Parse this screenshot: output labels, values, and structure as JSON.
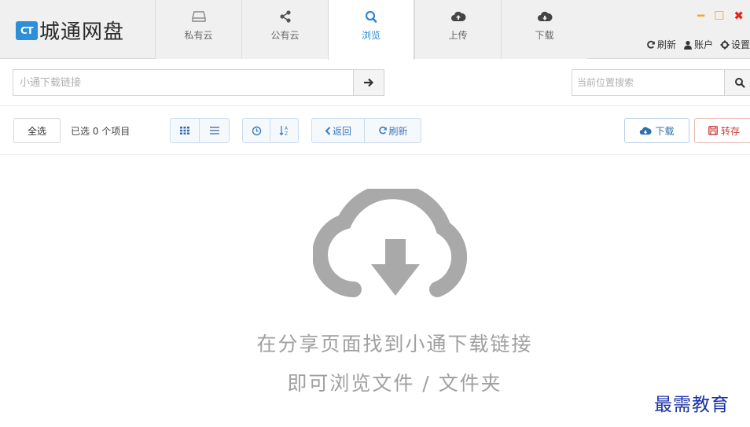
{
  "app": {
    "logo_mark": "CT",
    "name": "城通网盘"
  },
  "nav": {
    "tabs": [
      {
        "label": "私有云",
        "icon": "drive-icon"
      },
      {
        "label": "公有云",
        "icon": "share-icon"
      },
      {
        "label": "浏览",
        "icon": "search-icon",
        "active": true
      },
      {
        "label": "上传",
        "icon": "cloud-upload-icon"
      },
      {
        "label": "下载",
        "icon": "cloud-download-icon"
      }
    ]
  },
  "window_controls": {
    "minimize": "━",
    "maximize": "☐",
    "close": "✖"
  },
  "header_actions": {
    "refresh": "刷新",
    "account": "账户",
    "settings": "设置"
  },
  "link_bar": {
    "placeholder": "小通下载链接"
  },
  "search": {
    "placeholder": "当前位置搜索"
  },
  "toolbar": {
    "select_all": "全选",
    "selected_count": "已选 0 个项目",
    "back": "返回",
    "refresh": "刷新",
    "download": "下载",
    "save": "转存"
  },
  "empty_state": {
    "line1": "在分享页面找到小通下载链接",
    "line2": "即可浏览文件 / 文件夹"
  },
  "watermark": "最需教育",
  "colors": {
    "accent": "#2e87d4",
    "close_red": "#e0261c",
    "minimize_orange": "#f6a623",
    "save_red": "#d9534f"
  }
}
